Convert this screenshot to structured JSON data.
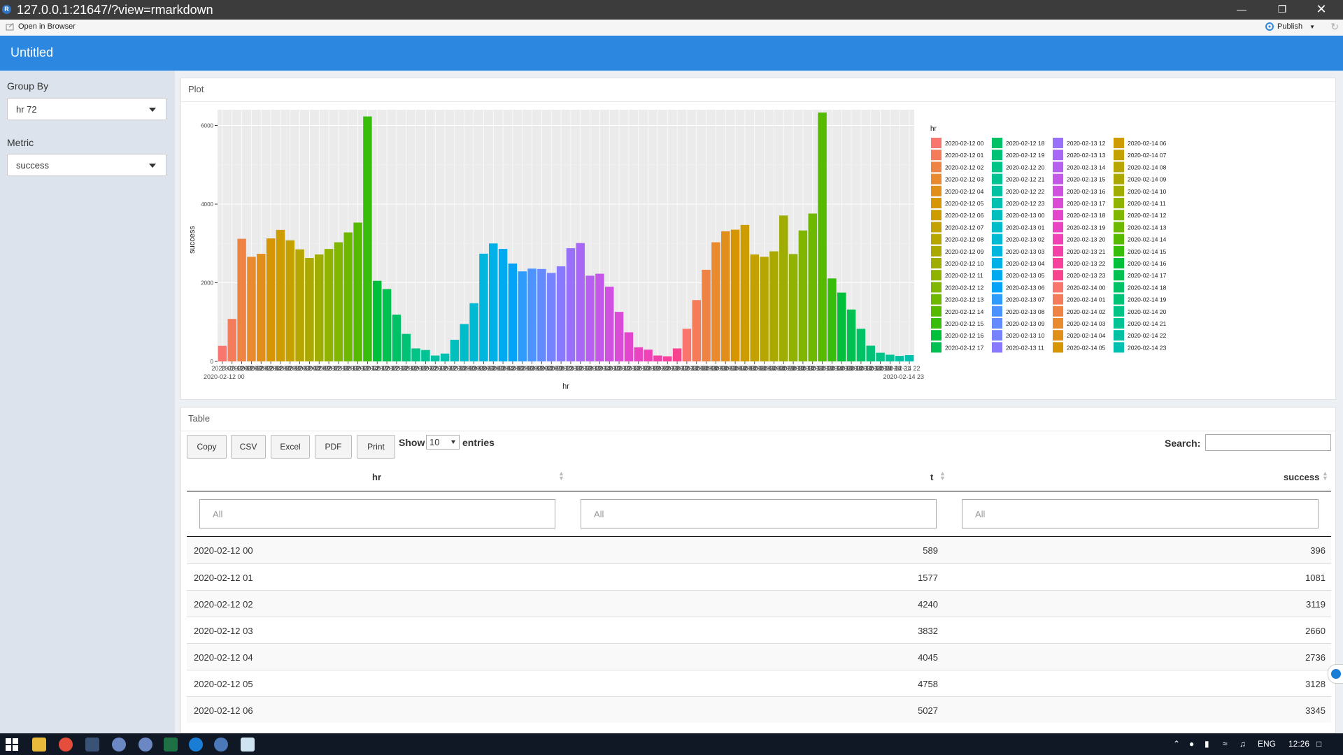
{
  "window": {
    "title": "127.0.0.1:21647/?view=rmarkdown"
  },
  "viewer_toolbar": {
    "open_in_browser": "Open in Browser",
    "publish": "Publish"
  },
  "app": {
    "title": "Untitled"
  },
  "sidebar": {
    "group_by": {
      "label": "Group By",
      "value": "hr 72"
    },
    "metric": {
      "label": "Metric",
      "value": "success"
    }
  },
  "plot_panel": {
    "title": "Plot"
  },
  "chart_data": {
    "type": "bar",
    "x_label": "hr",
    "y_label": "success",
    "y_ticks": [
      0,
      2000,
      4000,
      6000
    ],
    "ylim": [
      0,
      6400
    ],
    "grid": true,
    "legend_title": "hr",
    "legend_position": "right",
    "x_tick_labels_first": "2020-02-12 00",
    "x_tick_labels_last": "2020-02-14 23",
    "categories": [
      "2020-02-12 00",
      "2020-02-12 01",
      "2020-02-12 02",
      "2020-02-12 03",
      "2020-02-12 04",
      "2020-02-12 05",
      "2020-02-12 06",
      "2020-02-12 07",
      "2020-02-12 08",
      "2020-02-12 09",
      "2020-02-12 10",
      "2020-02-12 11",
      "2020-02-12 12",
      "2020-02-12 13",
      "2020-02-12 14",
      "2020-02-12 15",
      "2020-02-12 16",
      "2020-02-12 17",
      "2020-02-12 18",
      "2020-02-12 19",
      "2020-02-12 20",
      "2020-02-12 21",
      "2020-02-12 22",
      "2020-02-12 23",
      "2020-02-13 00",
      "2020-02-13 01",
      "2020-02-13 02",
      "2020-02-13 03",
      "2020-02-13 04",
      "2020-02-13 05",
      "2020-02-13 06",
      "2020-02-13 07",
      "2020-02-13 08",
      "2020-02-13 09",
      "2020-02-13 10",
      "2020-02-13 11",
      "2020-02-13 12",
      "2020-02-13 13",
      "2020-02-13 14",
      "2020-02-13 15",
      "2020-02-13 16",
      "2020-02-13 17",
      "2020-02-13 18",
      "2020-02-13 19",
      "2020-02-13 20",
      "2020-02-13 21",
      "2020-02-13 22",
      "2020-02-13 23",
      "2020-02-14 00",
      "2020-02-14 01",
      "2020-02-14 02",
      "2020-02-14 03",
      "2020-02-14 04",
      "2020-02-14 05",
      "2020-02-14 06",
      "2020-02-14 07",
      "2020-02-14 08",
      "2020-02-14 09",
      "2020-02-14 10",
      "2020-02-14 11",
      "2020-02-14 12",
      "2020-02-14 13",
      "2020-02-14 14",
      "2020-02-14 15",
      "2020-02-14 16",
      "2020-02-14 17",
      "2020-02-14 18",
      "2020-02-14 19",
      "2020-02-14 20",
      "2020-02-14 21",
      "2020-02-14 22",
      "2020-02-14 23"
    ],
    "values": [
      396,
      1081,
      3119,
      2660,
      2736,
      3128,
      3345,
      3080,
      2850,
      2630,
      2720,
      2860,
      3030,
      3280,
      3530,
      6230,
      2050,
      1840,
      1190,
      700,
      330,
      290,
      150,
      200,
      550,
      950,
      1480,
      2740,
      3000,
      2860,
      2490,
      2290,
      2360,
      2350,
      2250,
      2420,
      2880,
      3010,
      2180,
      2230,
      1900,
      1260,
      740,
      360,
      300,
      150,
      130,
      330,
      830,
      1560,
      2330,
      3030,
      3310,
      3350,
      3470,
      2720,
      2660,
      2800,
      3710,
      2730,
      3330,
      3760,
      6330,
      2110,
      1750,
      1320,
      830,
      400,
      220,
      170,
      140,
      160
    ],
    "colors": [
      "#F8766D",
      "#F47C5A",
      "#EF8344",
      "#E88A2D",
      "#E0901A",
      "#D69603",
      "#CC9C00",
      "#C2A100",
      "#B7A500",
      "#ABA900",
      "#9EAD00",
      "#90B200",
      "#80B500",
      "#6EB800",
      "#57BA00",
      "#38BD0C",
      "#00BF3A",
      "#00C051",
      "#00C165",
      "#00C276",
      "#00C386",
      "#00C394",
      "#00C2A2",
      "#00C1AF",
      "#00BFBC",
      "#00BCC8",
      "#00B9D3",
      "#00B5DE",
      "#00B0E7",
      "#00AAF0",
      "#04A3F7",
      "#2E9BFD",
      "#4C93FF",
      "#638BFF",
      "#7782FF",
      "#8879FE",
      "#9970FA",
      "#A967F5",
      "#B75FEF",
      "#C457E8",
      "#D050E0",
      "#DA4BD6",
      "#E346CC",
      "#EA43C1",
      "#F041B6",
      "#F440A9",
      "#F7419C",
      "#F8448F",
      "#F8766D",
      "#F47C5A",
      "#EF8344",
      "#E88A2D",
      "#E0901A",
      "#D69603",
      "#CC9C00",
      "#C2A100",
      "#B7A500",
      "#ABA900",
      "#9EAD00",
      "#90B200",
      "#80B500",
      "#6EB800",
      "#57BA00",
      "#38BD0C",
      "#00BF3A",
      "#00C051",
      "#00C165",
      "#00C276",
      "#00C386",
      "#00C394",
      "#00C2A2",
      "#00C1AF"
    ]
  },
  "table_panel": {
    "title": "Table"
  },
  "table": {
    "buttons": [
      "Copy",
      "CSV",
      "Excel",
      "PDF",
      "Print"
    ],
    "show_label": "Show",
    "entries_label": "entries",
    "page_length": "10",
    "search_label": "Search:",
    "columns": [
      "hr",
      "t",
      "success"
    ],
    "filter_placeholder": "All",
    "rows": [
      [
        "2020-02-12 00",
        "589",
        "396"
      ],
      [
        "2020-02-12 01",
        "1577",
        "1081"
      ],
      [
        "2020-02-12 02",
        "4240",
        "3119"
      ],
      [
        "2020-02-12 03",
        "3832",
        "2660"
      ],
      [
        "2020-02-12 04",
        "4045",
        "2736"
      ],
      [
        "2020-02-12 05",
        "4758",
        "3128"
      ],
      [
        "2020-02-12 06",
        "5027",
        "3345"
      ]
    ]
  },
  "taskbar": {
    "lang": "ENG",
    "time": "12:26"
  }
}
